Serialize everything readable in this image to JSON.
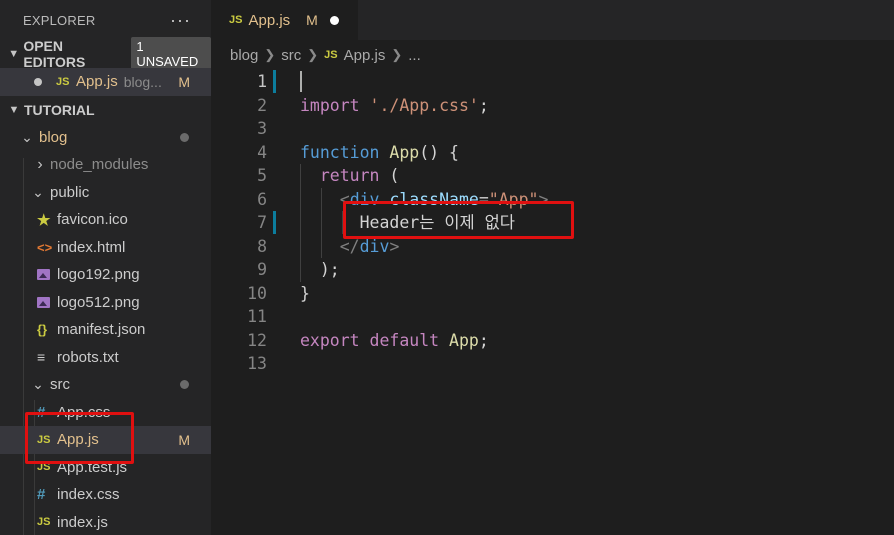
{
  "sidebar": {
    "title": "EXPLORER",
    "more": "···",
    "open_editors": {
      "label": "OPEN EDITORS",
      "badge": "1 UNSAVED",
      "items": [
        {
          "icon": "JS",
          "name": "App.js",
          "path": "blog...",
          "status": "M"
        }
      ]
    },
    "tutorial": {
      "label": "TUTORIAL"
    },
    "tree": {
      "blog": "blog",
      "node_modules": "node_modules",
      "public": "public",
      "public_files": [
        "favicon.ico",
        "index.html",
        "logo192.png",
        "logo512.png",
        "manifest.json",
        "robots.txt"
      ],
      "src": "src",
      "src_files": [
        "App.css",
        "App.js",
        "App.test.js",
        "index.css",
        "index.js"
      ],
      "app_js_status": "M"
    }
  },
  "tab": {
    "icon": "JS",
    "name": "App.js",
    "status": "M"
  },
  "breadcrumb": {
    "parts": [
      "blog",
      "src",
      "App.js",
      "..."
    ]
  },
  "editor": {
    "line_numbers": [
      "1",
      "2",
      "3",
      "4",
      "5",
      "6",
      "7",
      "8",
      "9",
      "10",
      "11",
      "12",
      "13"
    ],
    "lines": {
      "l2": {
        "kw": "import",
        "str": "'./App.css'",
        "end": ";"
      },
      "l4": {
        "kw": "function",
        "fn": "App",
        "rest": "() {"
      },
      "l5": {
        "kw": "return",
        "rest": " ("
      },
      "l6": {
        "open": "<",
        "tag": "div",
        "attr": "className",
        "eq": "=",
        "str": "\"App\"",
        "close": ">"
      },
      "l7": {
        "text": "Header는 이제 없다"
      },
      "l8": {
        "open": "</",
        "tag": "div",
        "close": ">"
      },
      "l9": {
        "text": ");"
      },
      "l10": {
        "text": "}"
      },
      "l12": {
        "kw": "export",
        "kw2": "default",
        "fn": "App",
        "end": ";"
      }
    }
  },
  "colors": {
    "highlight_box": "#e01010",
    "modified": "#e2c08d",
    "js_icon": "#cbcb41"
  }
}
